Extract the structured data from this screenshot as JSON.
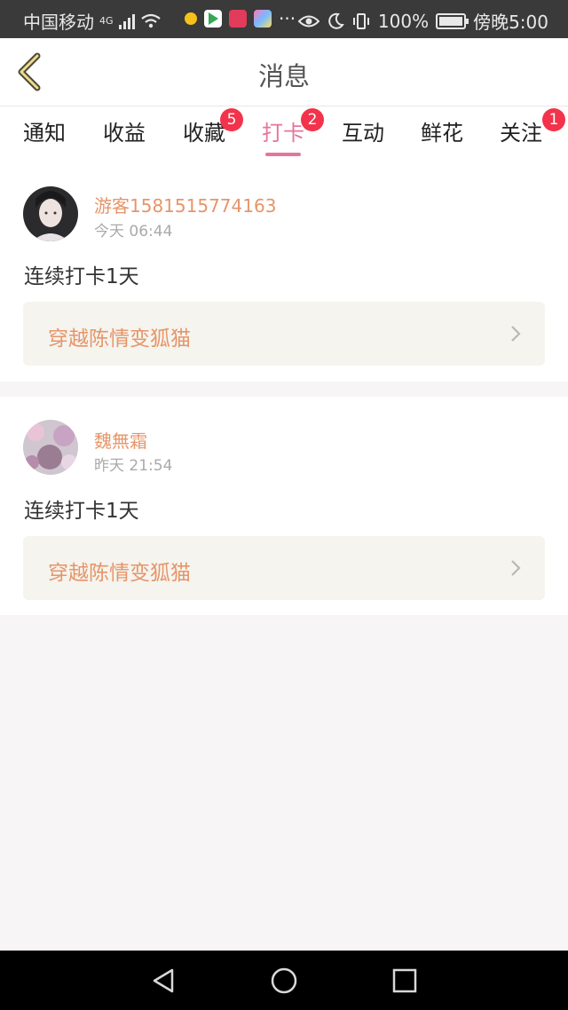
{
  "status_bar": {
    "carrier": "中国移动",
    "network": "4G",
    "battery": "100%",
    "time": "傍晚5:00",
    "more": "···"
  },
  "header": {
    "title": "消息",
    "back_icon": "chevron-left-icon"
  },
  "tabs": [
    {
      "label": "通知",
      "active": false
    },
    {
      "label": "收益",
      "active": false
    },
    {
      "label": "收藏",
      "active": false,
      "badge": "5"
    },
    {
      "label": "打卡",
      "active": true,
      "badge": "2"
    },
    {
      "label": "互动",
      "active": false
    },
    {
      "label": "鲜花",
      "active": false
    },
    {
      "label": "关注",
      "active": false,
      "badge": "1"
    }
  ],
  "messages": [
    {
      "username": "游客1581515774163",
      "time": "今天 06:44",
      "text": "连续打卡1天",
      "link": "穿越陈情变狐猫"
    },
    {
      "username": "魏無霜",
      "time": "昨天 21:54",
      "text": "连续打卡1天",
      "link": "穿越陈情变狐猫"
    }
  ],
  "colors": {
    "accent": "#e6759a",
    "username": "#e6956a",
    "badge": "#f2334b"
  }
}
